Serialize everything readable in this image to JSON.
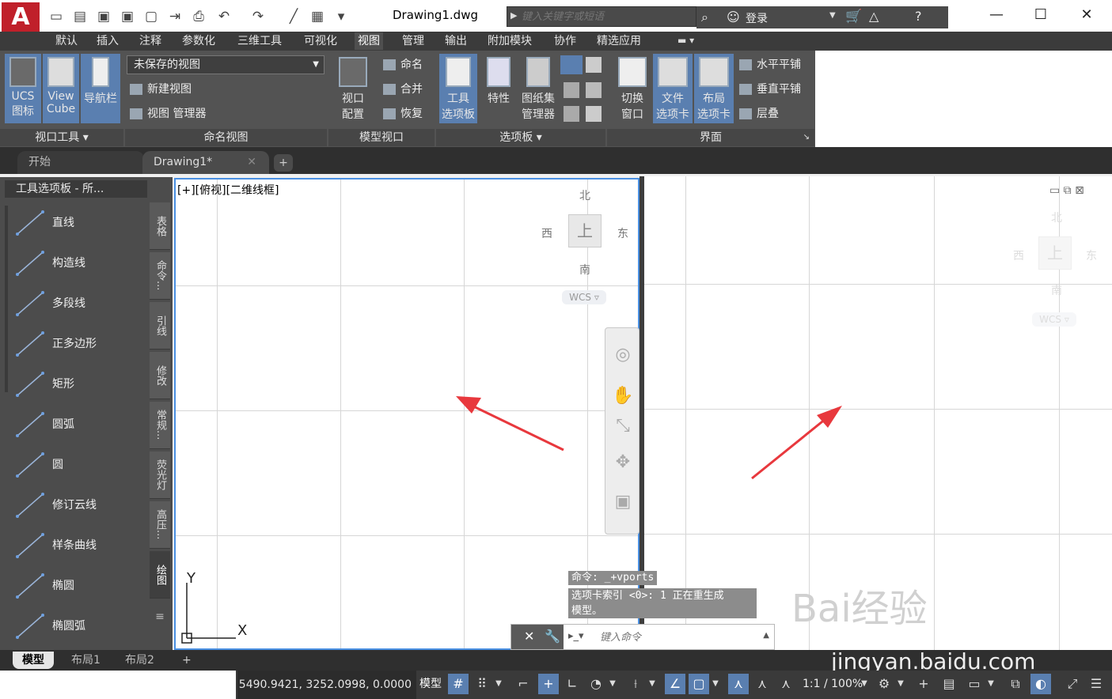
{
  "window": {
    "doc_title": "Drawing1.dwg",
    "search_placeholder": "键入关键字或短语",
    "login_label": "登录"
  },
  "ribbon": {
    "tabs": [
      {
        "label": "默认"
      },
      {
        "label": "插入"
      },
      {
        "label": "注释"
      },
      {
        "label": "参数化"
      },
      {
        "label": "三维工具"
      },
      {
        "label": "可视化"
      },
      {
        "label": "视图",
        "active": true
      },
      {
        "label": "管理"
      },
      {
        "label": "输出"
      },
      {
        "label": "附加模块"
      },
      {
        "label": "协作"
      },
      {
        "label": "精选应用"
      }
    ],
    "viewport_tools": {
      "ucs_line1": "UCS",
      "ucs_line2": "图标",
      "viewcube_line1": "View",
      "viewcube_line2": "Cube",
      "navbar": "导航栏",
      "panel_label": "视口工具"
    },
    "named_views": {
      "select_value": "未保存的视图",
      "new_view": "新建视图",
      "view_manager": "视图 管理器",
      "panel_label": "命名视图"
    },
    "model_viewports": {
      "config_line1": "视口",
      "config_line2": "配置",
      "name": "命名",
      "join": "合并",
      "restore": "恢复",
      "panel_label": "模型视口"
    },
    "palettes": {
      "tool_line1": "工具",
      "tool_line2": "选项板",
      "properties": "特性",
      "sheetset_line1": "图纸集",
      "sheetset_line2": "管理器",
      "panel_label": "选项板"
    },
    "interface": {
      "switch_line1": "切换",
      "switch_line2": "窗口",
      "filetab_line1": "文件",
      "filetab_line2": "选项卡",
      "layouttab_line1": "布局",
      "layouttab_line2": "选项卡",
      "tile_h": "水平平铺",
      "tile_v": "垂直平铺",
      "cascade": "层叠",
      "panel_label": "界面"
    }
  },
  "doc_tabs": [
    {
      "label": "开始"
    },
    {
      "label": "Drawing1*",
      "active": true
    }
  ],
  "palette": {
    "title": "工具选项板 - 所...",
    "tools": [
      "直线",
      "构造线",
      "多段线",
      "正多边形",
      "矩形",
      "圆弧",
      "圆",
      "修订云线",
      "样条曲线",
      "椭圆",
      "椭圆弧"
    ],
    "side_tabs": [
      "表格",
      "命令...",
      "引线",
      "修改",
      "常规...",
      "荧光灯",
      "高压...",
      "绘图"
    ]
  },
  "viewport": {
    "label": "[+][俯视][二维线框]",
    "north": "北",
    "south": "南",
    "east": "东",
    "west": "西",
    "top_face": "上",
    "wcs": "WCS",
    "axis_x": "X",
    "axis_y": "Y"
  },
  "command": {
    "history1": "命令: _+vports",
    "history2_line1": "选项卡索引 <0>: 1 正在重生成",
    "history2_line2": "模型。",
    "placeholder": "键入命令"
  },
  "layout_tabs": [
    {
      "label": "模型",
      "active": true
    },
    {
      "label": "布局1"
    },
    {
      "label": "布局2"
    }
  ],
  "status": {
    "coords": "5490.9421, 3252.0998, 0.0000",
    "model": "模型",
    "scale": "1:1 / 100%"
  },
  "watermark": {
    "text": "Bai经验",
    "url": "jingyan.baidu.com"
  },
  "colors": {
    "accent": "#5a7fb0",
    "arrow": "#e8383d",
    "viewport_border": "#4a90e2"
  }
}
